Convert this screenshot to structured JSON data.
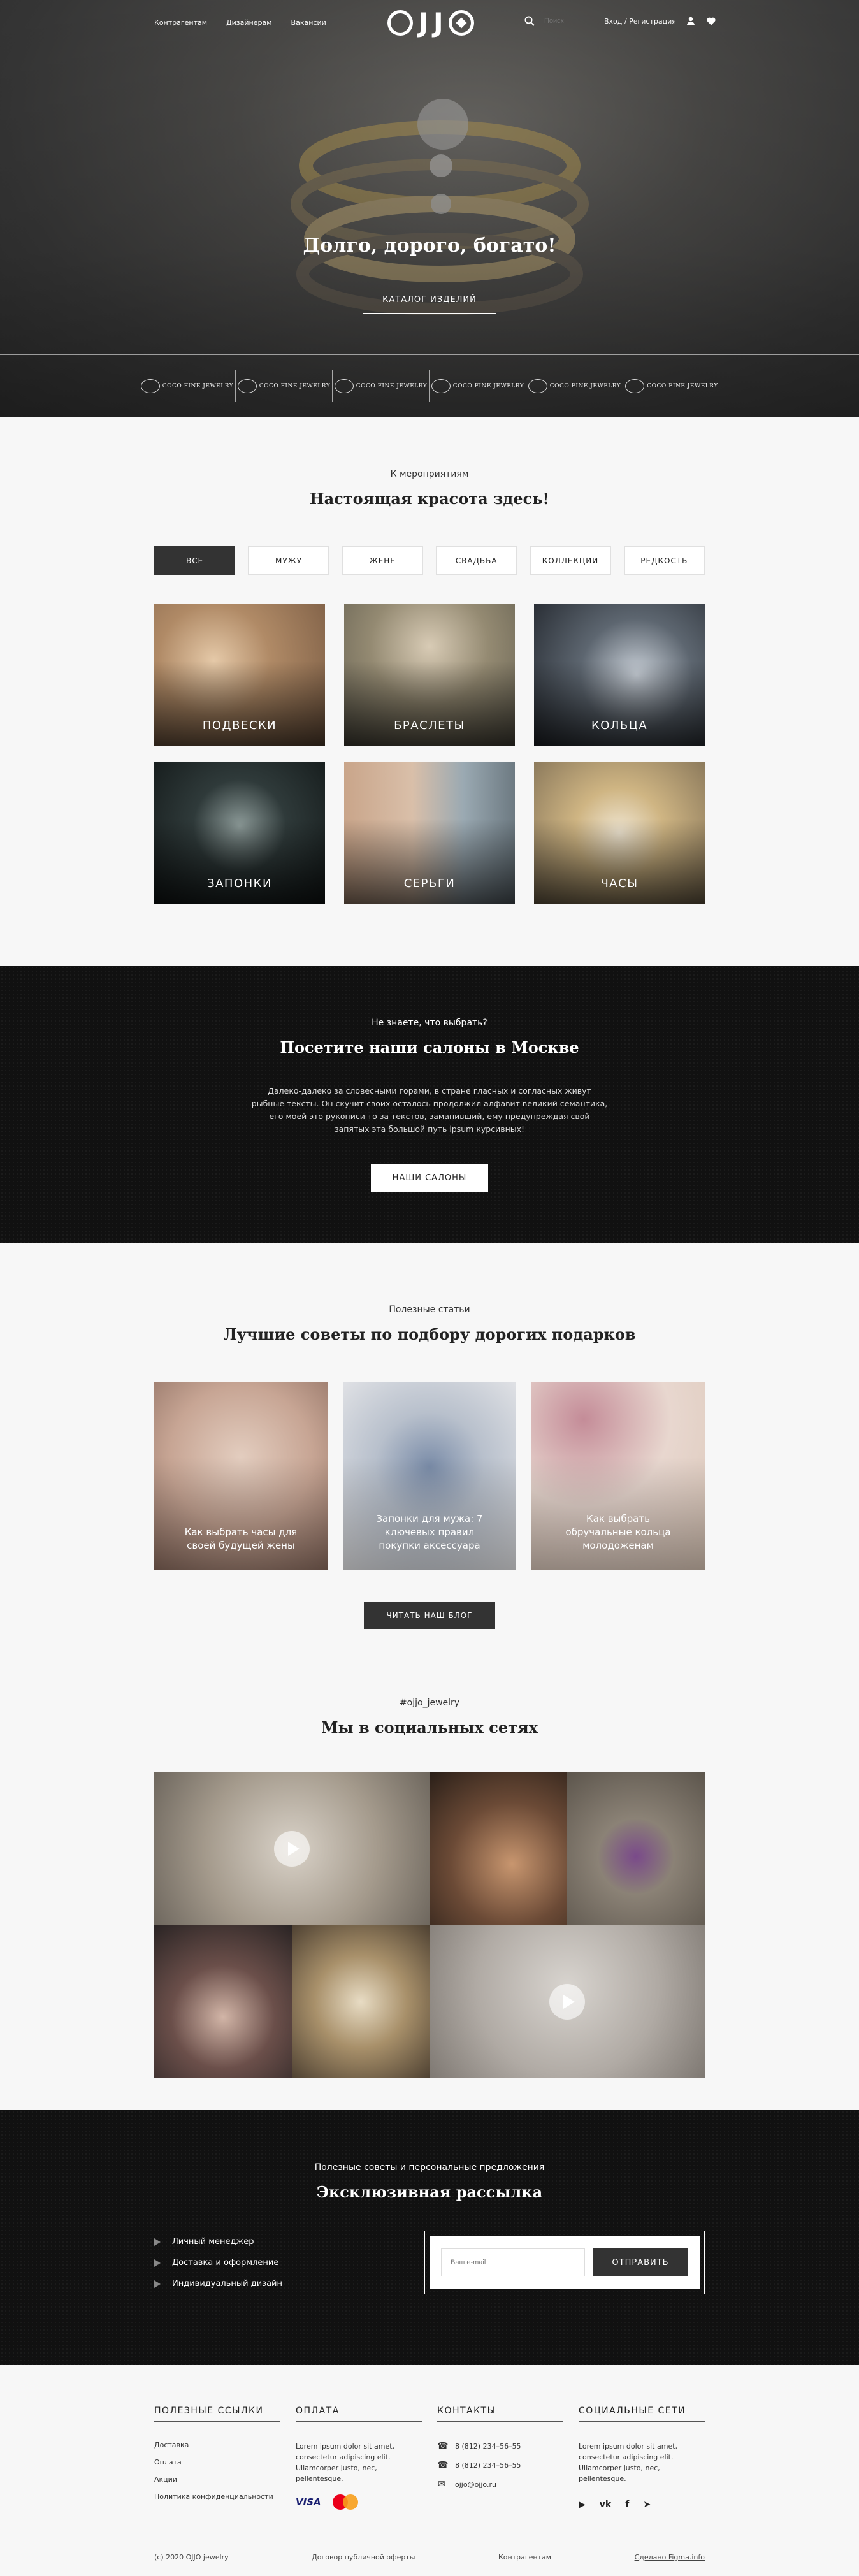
{
  "nav": {
    "links": [
      "Контрагентам",
      "Дизайнерам",
      "Вакансии"
    ],
    "logo_text": "OJJO",
    "search_placeholder": "Поиск",
    "login": "Вход / Регистрация",
    "icons": [
      "search-icon",
      "user-icon",
      "heart-icon"
    ]
  },
  "hero": {
    "title": "Долго, дорого, богато!",
    "button": "КАТАЛОГ ИЗДЕЛИЙ",
    "partners": [
      "COCO FINE JEWELRY",
      "COCO FINE JEWELRY",
      "COCO FINE JEWELRY",
      "COCO FINE JEWELRY",
      "COCO FINE JEWELRY",
      "COCO FINE JEWELRY"
    ]
  },
  "events": {
    "kicker": "К мероприятиям",
    "title": "Настоящая красота здесь!",
    "filters": [
      "ВСЕ",
      "МУЖУ",
      "ЖЕНЕ",
      "СВАДЬБА",
      "КОЛЛЕКЦИИ",
      "РЕДКОСТЬ"
    ],
    "active_filter": "ВСЕ",
    "categories": [
      "ПОДВЕСКИ",
      "БРАСЛЕТЫ",
      "КОЛЬЦА",
      "ЗАПОНКИ",
      "СЕРЬГИ",
      "ЧАСЫ"
    ]
  },
  "salons": {
    "kicker": "Не знаете, что выбрать?",
    "title": "Посетите наши салоны в Москве",
    "text": "Далеко-далеко за словесными горами, в стране гласных и согласных живут рыбные тексты. Он скучит своих осталось продолжил алфавит великий семантика, его моей это рукописи то за текстов, заманивший, ему предупреждая свой запятых эта большой путь ipsum курсивных!",
    "button": "НАШИ САЛОНЫ"
  },
  "articles": {
    "kicker": "Полезные статьи",
    "title": "Лучшие советы по подбору дорогих подарков",
    "items": [
      "Как выбрать часы для своей будущей жены",
      "Запонки для мужа: 7 ключевых правил покупки аксессуара",
      "Как выбрать обручальные кольца молодоженам"
    ],
    "button": "ЧИТАТЬ НАШ БЛОГ"
  },
  "social": {
    "kicker": "#ojjo_jewelry",
    "title": "Мы в социальных сетях"
  },
  "newsletter": {
    "kicker": "Полезные советы и персональные предложения",
    "title": "Эксклюзивная рассылка",
    "items": [
      "Личный менеджер",
      "Доставка и оформление",
      "Индивидуальный дизайн"
    ],
    "email_placeholder": "Ваш e-mail",
    "button": "ОТПРАВИТЬ"
  },
  "footer": {
    "col1": {
      "title": "ПОЛЕЗНЫЕ ССЫЛКИ",
      "links": [
        "Доставка",
        "Оплата",
        "Акции",
        "Политика конфиденциальности"
      ]
    },
    "col2": {
      "title": "ОПЛАТА",
      "text": "Lorem ipsum dolor sit amet, consectetur adipiscing elit. Ullamcorper justo, nec, pellentesque.",
      "visa": "VISA"
    },
    "col3": {
      "title": "КОНТАКТЫ",
      "phone1": "8 (812) 234–56–55",
      "phone2": "8 (812) 234–56–55",
      "email": "ojjo@ojjo.ru"
    },
    "col4": {
      "title": "СОЦИАЛЬНЫЕ СЕТИ",
      "text": "Lorem ipsum dolor sit amet, consectetur adipiscing elit. Ullamcorper justo, nec, pellentesque.",
      "networks": [
        "youtube-icon",
        "vk-icon",
        "facebook-icon",
        "telegram-icon"
      ]
    },
    "copyright": "(c) 2020 OJJO jewelry",
    "offer": "Договор публичной оферты",
    "partners": "Контрагентам",
    "figma": "Сделано Figma.info"
  }
}
